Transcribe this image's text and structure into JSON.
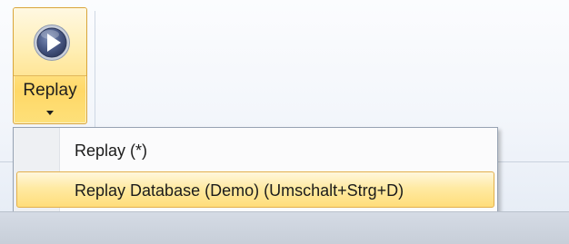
{
  "ribbon": {
    "replay_button": {
      "label": "Replay",
      "icon": "play-circle-icon"
    }
  },
  "menu": {
    "items": [
      {
        "label": "Replay (*)",
        "highlighted": false
      },
      {
        "label": "Replay Database (Demo) (Umschalt+Strg+D)",
        "highlighted": true
      }
    ]
  },
  "colors": {
    "highlight_border": "#d9a53a",
    "highlight_fill": "#ffe89a",
    "play_icon_fill": "#4a5a86",
    "menu_border": "#97a3b3"
  }
}
